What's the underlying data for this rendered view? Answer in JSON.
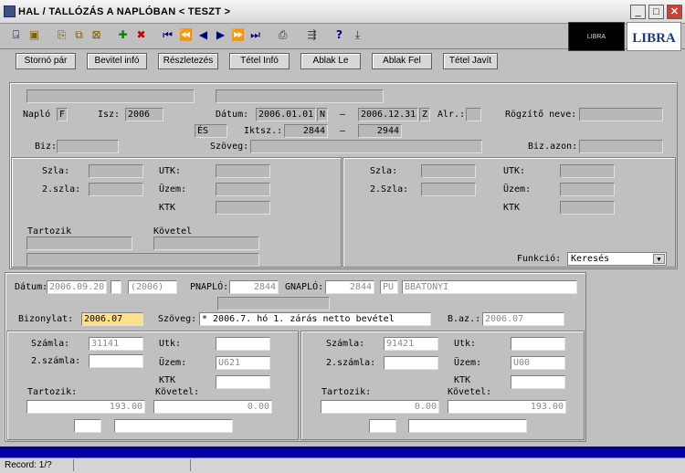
{
  "window": {
    "title": "HAL / TALLÓZÁS A NAPLÓBAN  < TESZT >",
    "min": "_",
    "max": "□",
    "close": "✕"
  },
  "toolbar": {
    "icons": [
      "door-exit-icon",
      "save-icon",
      "query-icon",
      "copy-icon",
      "delete-doc-icon",
      "add-icon",
      "remove-icon",
      "first-icon",
      "prev-page-icon",
      "prev-icon",
      "next-icon",
      "next-page-icon",
      "last-icon",
      "print-icon",
      "arrows-icon",
      "help-icon",
      "download-icon"
    ]
  },
  "logos": {
    "left": "LIBRA",
    "right": "LIBRA"
  },
  "buttons": {
    "storno": "Stornó pár",
    "bevitel": "Bevitel infó",
    "reszletezes": "Részletezés",
    "tetelinfo": "Tétel Infó",
    "ablakle": "Ablak Le",
    "ablakfel": "Ablak Fel",
    "tetjavit": "Tétel Javít"
  },
  "search": {
    "naplo_label": "Napló",
    "naplo": "F",
    "isz_label": "Isz:",
    "isz": "2006",
    "datum_label": "Dátum:",
    "datum_from": "2006.01.01",
    "datum_from_flag": "N",
    "dash": "–",
    "datum_to": "2006.12.31",
    "datum_to_flag": "Z",
    "alr_label": "Alr.:",
    "rogzito_label": "Rögzítő neve:",
    "es": "ÉS",
    "iktsz_label": "Iktsz.:",
    "iktsz_from": "2844",
    "iktsz_to": "2944",
    "biz_label": "Biz:",
    "szoveg_label": "Szöveg:",
    "bizazon_label": "Biz.azon:",
    "szla_label": "Szla:",
    "szla2_label": "2.szla:",
    "szla2b_label": "2.Szla:",
    "utk_label": "UTK:",
    "uzem_label": "Üzem:",
    "ktk_label": "KTK",
    "tartozik_label": "Tartozik",
    "kovetel_label": "Követel",
    "funkcio_label": "Funkció:",
    "funkcio": "Keresés",
    "funkcio_arrow": "▼"
  },
  "record": {
    "datum_label": "Dátum:",
    "datum": "2006.09.20",
    "ev": "(2006)",
    "pnaplo_label": "PNAPLÓ:",
    "pnaplo": "2844",
    "gnaplo_label": "GNAPLÓ:",
    "gnaplo": "2844",
    "gnaplo_code": "PU",
    "gnaplo_name": "BBATONYI",
    "bizonylat_label": "Bizonylat:",
    "bizonylat": "2006.07",
    "szoveg_label": "Szöveg:",
    "szoveg": "* 2006.7. hó 1. zárás netto bevétel",
    "baz_label": "B.az.:",
    "baz": "2006.07",
    "left": {
      "szamla_label": "Számla:",
      "szamla": "31141",
      "szamla2_label": "2.számla:",
      "utk_label": "Utk:",
      "uzem_label": "Üzem:",
      "uzem": "U621",
      "ktk_label": "KTK",
      "tartozik_label": "Tartozik:",
      "tartozik": "193.00",
      "kovetel_label": "Követel:",
      "kovetel": "0.00"
    },
    "right": {
      "szamla_label": "Számla:",
      "szamla": "91421",
      "szamla2_label": "2.számla:",
      "utk_label": "Utk:",
      "uzem_label": "Üzem:",
      "uzem": "U00",
      "ktk_label": "KTK",
      "tartozik_label": "Tartozik:",
      "tartozik": "0.00",
      "kovetel_label": "Követel:",
      "kovetel": "193.00"
    }
  },
  "statusbar": {
    "record": "Record: 1/?"
  }
}
